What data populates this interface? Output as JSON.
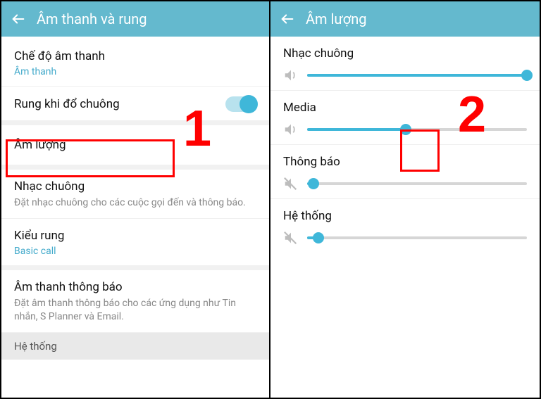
{
  "left": {
    "header": {
      "title": "Âm thanh và rung"
    },
    "items": [
      {
        "title": "Chế độ âm thanh",
        "sub": "Âm thanh"
      },
      {
        "title": "Rung khi đổ chuông",
        "toggle": true
      },
      {
        "title": "Âm lượng"
      },
      {
        "title": "Nhạc chuông",
        "desc": "Đặt nhạc chuông cho các cuộc gọi đến và thông báo."
      },
      {
        "title": "Kiểu rung",
        "sub": "Basic call"
      },
      {
        "title": "Âm thanh thông báo",
        "desc": "Đặt âm thanh thông báo cho các ứng dụng như Tin nhắn, S Planner và Email."
      }
    ],
    "section_header": "Hệ thống",
    "callout": "1"
  },
  "right": {
    "header": {
      "title": "Âm lượng"
    },
    "sliders": [
      {
        "label": "Nhạc chuông",
        "value": 100,
        "muted": false
      },
      {
        "label": "Media",
        "value": 45,
        "muted": false
      },
      {
        "label": "Thông báo",
        "value": 3,
        "muted": true
      },
      {
        "label": "Hệ thống",
        "value": 5,
        "muted": true
      }
    ],
    "callout": "2"
  },
  "colors": {
    "accent": "#3fb7d9",
    "header_bg": "#64b9ce",
    "red": "#ff0000"
  }
}
